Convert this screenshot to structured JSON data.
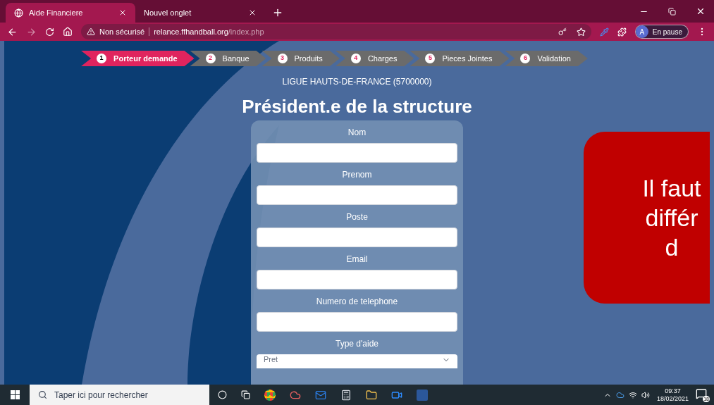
{
  "browser": {
    "tabs": [
      {
        "title": "Aide Financiere",
        "selected": true
      },
      {
        "title": "Nouvel onglet",
        "selected": false
      }
    ],
    "security": "Non sécurisé",
    "url_host": "relance.ffhandball.org",
    "url_path": "/index.php",
    "profile_initial": "A",
    "profile_status": "En pause"
  },
  "steps": [
    {
      "number": "1",
      "label": "Porteur demande",
      "selected": true
    },
    {
      "number": "2",
      "label": "Banque",
      "selected": false
    },
    {
      "number": "3",
      "label": "Produits",
      "selected": false
    },
    {
      "number": "4",
      "label": "Charges",
      "selected": false
    },
    {
      "number": "5",
      "label": "Pieces Jointes",
      "selected": false
    },
    {
      "number": "6",
      "label": "Validation",
      "selected": false
    }
  ],
  "organization": "LIGUE HAUTS-DE-FRANCE (5700000)",
  "heading": "Président.e de la structure",
  "fields": [
    {
      "label": "Nom",
      "kind": "text"
    },
    {
      "label": "Prenom",
      "kind": "text"
    },
    {
      "label": "Poste",
      "kind": "text"
    },
    {
      "label": "Email",
      "kind": "text"
    },
    {
      "label": "Numero de telephone",
      "kind": "text"
    },
    {
      "label": "Type d'aide",
      "kind": "select",
      "value": "Pret"
    }
  ],
  "callout": {
    "lines": [
      "Il faut",
      "différ",
      "d"
    ]
  },
  "taskbar": {
    "search_placeholder": "Taper ici pour rechercher",
    "time": "09:37",
    "date": "18/02/2021",
    "notification_count": "18"
  }
}
